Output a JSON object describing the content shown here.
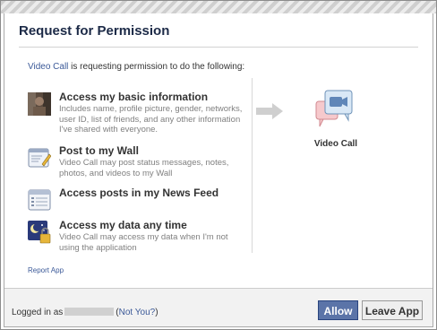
{
  "dialog": {
    "title": "Request for Permission",
    "intro_app": "Video Call",
    "intro_text": " is requesting permission to do the following:",
    "report_link": "Report App"
  },
  "permissions": [
    {
      "title": "Access my basic information",
      "desc": "Includes name, profile picture, gender, networks, user ID, list of friends, and any other information I've shared with everyone.",
      "icon": "profile-photo-icon"
    },
    {
      "title": "Post to my Wall",
      "desc": "Video Call may post status messages, notes, photos, and videos to my Wall",
      "icon": "wall-post-icon"
    },
    {
      "title": "Access posts in my News Feed",
      "desc": "",
      "icon": "news-feed-icon"
    },
    {
      "title": "Access my data any time",
      "desc": "Video Call may access my data when I'm not using the application",
      "icon": "offline-access-icon"
    }
  ],
  "app": {
    "name": "Video Call",
    "icon": "video-call-icon"
  },
  "footer": {
    "logged_in_label": "Logged in as",
    "not_you_open": "(",
    "not_you": "Not You?",
    "not_you_close": ")",
    "allow_label": "Allow",
    "leave_label": "Leave App"
  },
  "colors": {
    "link": "#3b5998",
    "title": "#1c2a47",
    "allow_bg": "#5b74a8"
  }
}
